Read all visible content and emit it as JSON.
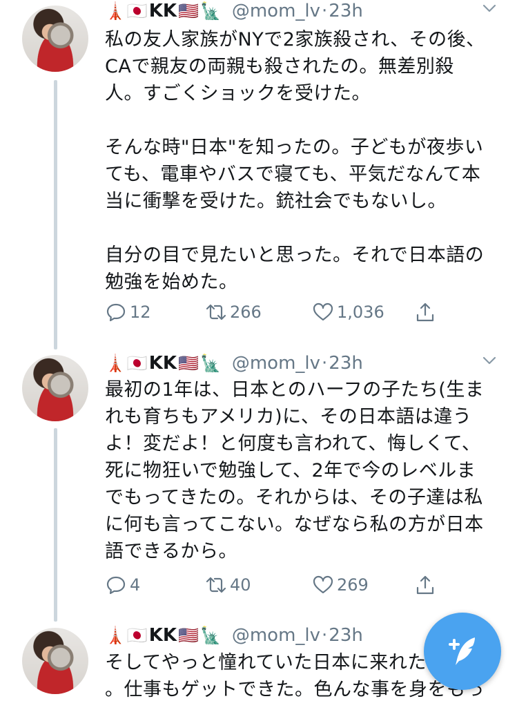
{
  "tweets": [
    {
      "emoji_tower": "🗼",
      "emoji_flag_jp": "🇯🇵",
      "name": "KK",
      "emoji_flag_us": "🇺🇸",
      "emoji_liberty": "🗽",
      "handle": "@mom_lv",
      "separator": "·",
      "time": "23h",
      "text": "私の友人家族がNYで2家族殺され、その後、\nCAで親友の両親も殺されたの。無差別殺\n人。すごくショックを受けた。\n\nそんな時\"日本\"を知ったの。子どもが夜歩い\nても、電車やバスで寝ても、平気だなんて本\n当に衝撃を受けた。銃社会でもないし。\n\n自分の目で見たいと思った。それで日本語の\n勉強を始めた。",
      "replies": "12",
      "retweets": "266",
      "likes": "1,036"
    },
    {
      "emoji_tower": "🗼",
      "emoji_flag_jp": "🇯🇵",
      "name": "KK",
      "emoji_flag_us": "🇺🇸",
      "emoji_liberty": "🗽",
      "handle": "@mom_lv",
      "separator": "·",
      "time": "23h",
      "text": "最初の1年は、日本とのハーフの子たち(生ま\nれも育ちもアメリカ)に、その日本語は違う\nよ！変だよ！と何度も言われて、悔しくて、\n死に物狂いで勉強して、2年で今のレベルま\nでもってきたの。それからは、その子達は私\nに何も言ってこない。なぜなら私の方が日本\n語できるから。",
      "replies": "4",
      "retweets": "40",
      "likes": "269"
    },
    {
      "emoji_tower": "🗼",
      "emoji_flag_jp": "🇯🇵",
      "name": "KK",
      "emoji_flag_us": "🇺🇸",
      "emoji_liberty": "🗽",
      "handle": "@mom_lv",
      "separator": "·",
      "time": "23h",
      "text": "そしてやっと憧れていた日本に来れた\n。仕事もゲットできた。色んな事を身をもっ"
    }
  ],
  "icons": {
    "reply": "reply-icon",
    "retweet": "retweet-icon",
    "like": "heart-icon",
    "share": "share-icon",
    "more": "chevron-down-icon",
    "compose": "compose-tweet-icon"
  },
  "colors": {
    "accent": "#4aa3f0",
    "secondary_text": "#657786",
    "thread_line": "#ccd6dd"
  }
}
